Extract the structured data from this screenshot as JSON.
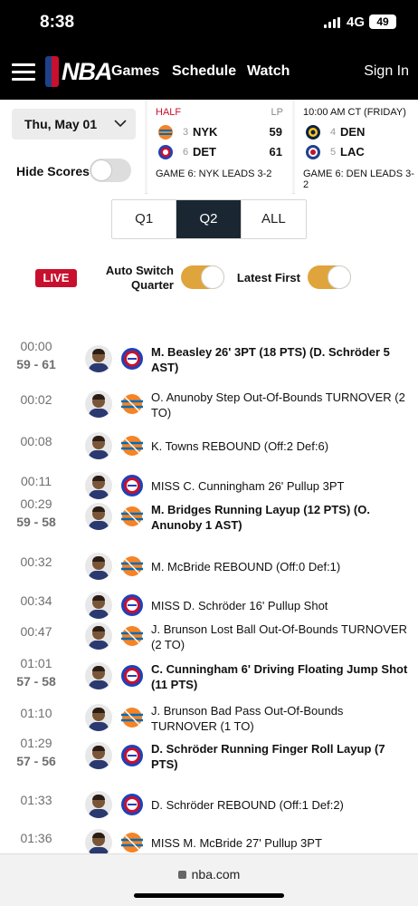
{
  "status_bar": {
    "time": "8:38",
    "network": "4G",
    "battery": "49"
  },
  "nav": {
    "logo_text": "NBA",
    "links": [
      "Games",
      "Schedule",
      "Watch"
    ],
    "sign_in": "Sign In"
  },
  "date_picker": {
    "value": "Thu, May 01"
  },
  "hide_scores": {
    "label": "Hide Scores",
    "enabled": false
  },
  "games": [
    {
      "status": "HALF",
      "tag": "LP",
      "teams": [
        {
          "seed": "3",
          "abbr": "NYK",
          "score": "59",
          "logo": "knicks-logo"
        },
        {
          "seed": "6",
          "abbr": "DET",
          "score": "61",
          "logo": "pistons-logo"
        }
      ],
      "note": "GAME 6: NYK LEADS 3-2"
    },
    {
      "status": "10:00 AM CT (FRIDAY)",
      "teams": [
        {
          "seed": "4",
          "abbr": "DEN",
          "logo": "nuggets-logo"
        },
        {
          "seed": "5",
          "abbr": "LAC",
          "logo": "clippers-logo"
        }
      ],
      "note": "GAME 6: DEN LEADS 3-2"
    }
  ],
  "quarter_tabs": {
    "items": [
      "Q1",
      "Q2",
      "ALL"
    ],
    "active": "Q2"
  },
  "live_badge": "LIVE",
  "auto_switch": {
    "label_line1": "Auto Switch",
    "label_line2": "Quarter",
    "enabled": true
  },
  "latest_first": {
    "label": "Latest First",
    "enabled": true
  },
  "colors": {
    "live_red": "#c8102e",
    "active_tab": "#1a2733",
    "toggle_on": "#e0a43c",
    "knicks_orange": "#f58426",
    "knicks_blue": "#006bb6",
    "pistons_blue": "#1d42ba",
    "pistons_red": "#c8102e"
  },
  "plays": [
    {
      "time": "00:00",
      "score": "59 - 61",
      "team": "DET",
      "description": "M. Beasley 26' 3PT (18 PTS) (D. Schröder 5 AST)",
      "bold": true
    },
    {
      "time": "00:02",
      "score": "",
      "team": "NYK",
      "description": "O. Anunoby Step Out-Of-Bounds TURNOVER (2 TO)",
      "bold": false
    },
    {
      "time": "00:08",
      "score": "",
      "team": "NYK",
      "description": "K. Towns REBOUND (Off:2 Def:6)",
      "bold": false
    },
    {
      "time": "00:11",
      "score": "",
      "team": "DET",
      "description": "MISS C. Cunningham 26' Pullup 3PT",
      "bold": false
    },
    {
      "time": "00:29",
      "score": "59 - 58",
      "team": "NYK",
      "description": "M. Bridges Running Layup (12 PTS) (O. Anunoby 1 AST)",
      "bold": true
    },
    {
      "time": "00:32",
      "score": "",
      "team": "NYK",
      "description": "M. McBride REBOUND (Off:0 Def:1)",
      "bold": false
    },
    {
      "time": "00:34",
      "score": "",
      "team": "DET",
      "description": "MISS D. Schröder 16' Pullup Shot",
      "bold": false
    },
    {
      "time": "00:47",
      "score": "",
      "team": "NYK",
      "description": "J. Brunson Lost Ball Out-Of-Bounds TURNOVER (2 TO)",
      "bold": false
    },
    {
      "time": "01:01",
      "score": "57 - 58",
      "team": "DET",
      "description": "C. Cunningham 6' Driving Floating Jump Shot (11 PTS)",
      "bold": true
    },
    {
      "time": "01:10",
      "score": "",
      "team": "NYK",
      "description": "J. Brunson Bad Pass Out-Of-Bounds TURNOVER (1 TO)",
      "bold": false
    },
    {
      "time": "01:29",
      "score": "57 - 56",
      "team": "DET",
      "description": "D. Schröder Running Finger Roll Layup (7 PTS)",
      "bold": true
    },
    {
      "time": "01:33",
      "score": "",
      "team": "DET",
      "description": "D. Schröder REBOUND (Off:1 Def:2)",
      "bold": false
    },
    {
      "time": "01:36",
      "score": "",
      "team": "NYK",
      "description": "MISS M. McBride 27' Pullup 3PT",
      "bold": false
    }
  ],
  "url_bar": {
    "url": "nba.com"
  }
}
